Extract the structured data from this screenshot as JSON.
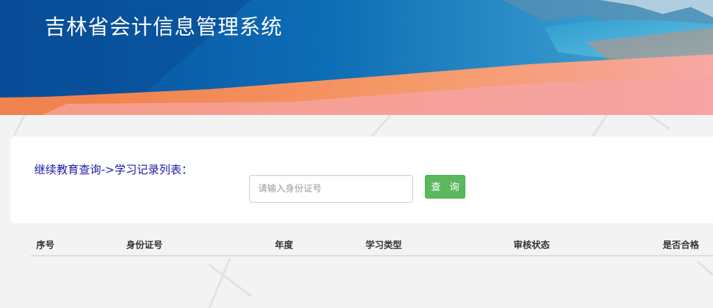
{
  "header": {
    "title": "吉林省会计信息管理系统"
  },
  "search": {
    "breadcrumb": "继续教育查询->学习记录列表：",
    "id_placeholder": "请输入身份证号",
    "id_value": "",
    "query_label": "查 询"
  },
  "table": {
    "columns": [
      "序号",
      "身份证号",
      "年度",
      "学习类型",
      "审核状态",
      "是否合格"
    ],
    "rows": []
  },
  "colors": {
    "banner_blue": "#0a6fb6",
    "banner_orange": "#f28a5a",
    "banner_pink": "#f6a5a0",
    "breadcrumb_text": "#1a1aa8",
    "query_button": "#5cb85c"
  }
}
